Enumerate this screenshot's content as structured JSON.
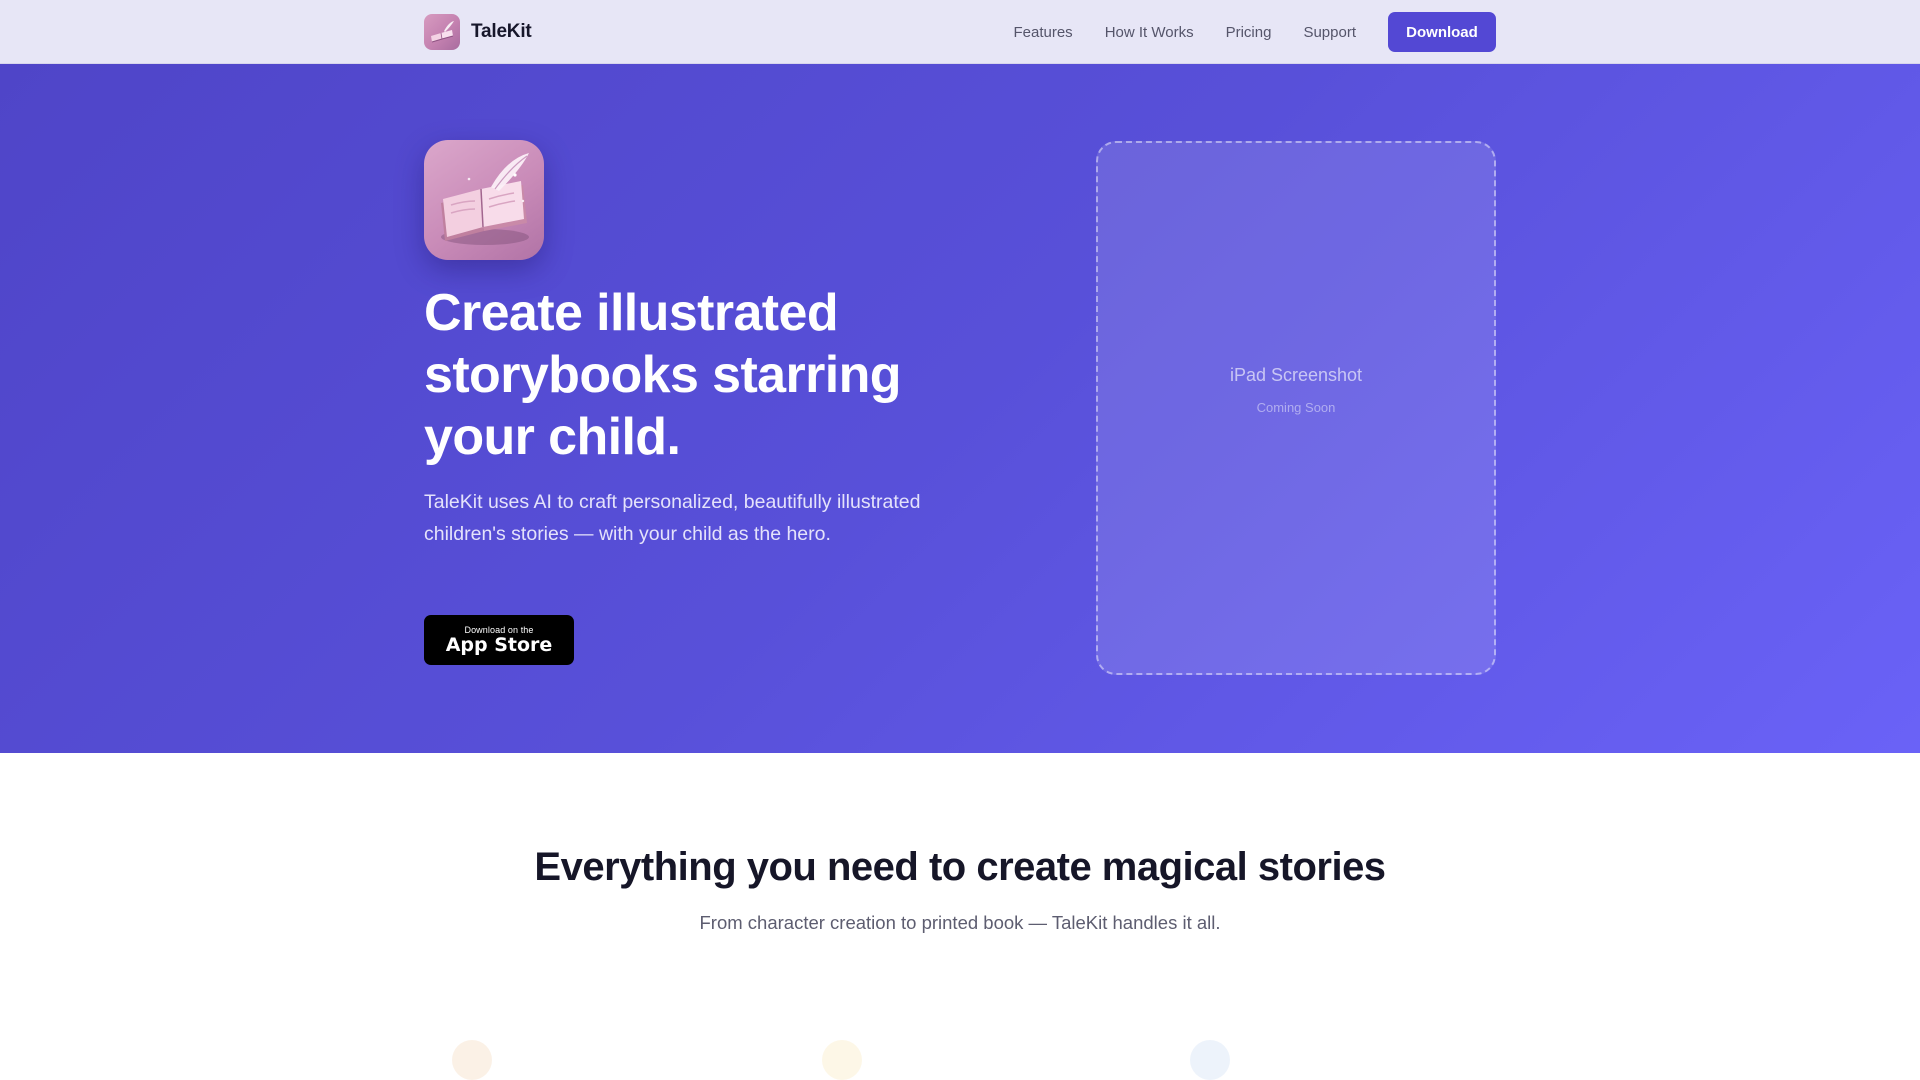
{
  "nav": {
    "brand": "TaleKit",
    "links": [
      "Features",
      "How It Works",
      "Pricing",
      "Support"
    ],
    "cta": "Download"
  },
  "hero": {
    "title": "Create illustrated storybooks starring your child.",
    "subtitle": "TaleKit uses AI to craft personalized, beautifully illustrated children's stories — with your child as the hero.",
    "badge_small": "Download on the",
    "badge_big": "App Store",
    "placeholder_title": "iPad Screenshot",
    "placeholder_sub": "Coming Soon"
  },
  "features": {
    "title": "Everything you need to create magical stories",
    "subtitle": "From character creation to printed book — TaleKit handles it all."
  },
  "colors": {
    "brand_primary": "#5348d4",
    "hero_gradient_start": "#4f45c8",
    "hero_gradient_end": "#6a62f7",
    "nav_background": "#e7e6f6"
  }
}
